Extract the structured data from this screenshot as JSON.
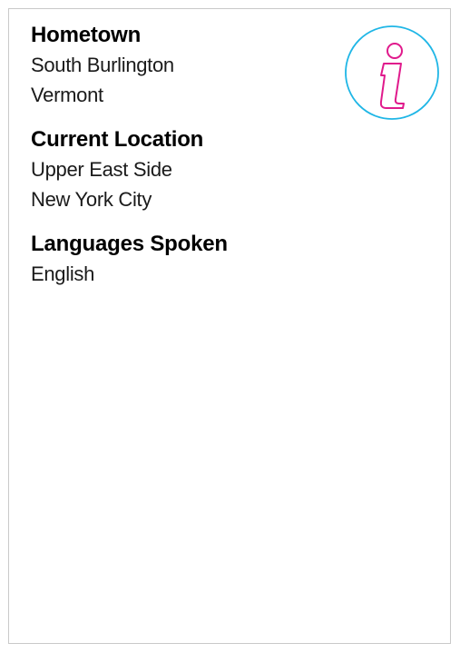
{
  "profile": {
    "sections": [
      {
        "heading": "Hometown",
        "lines": [
          "South Burlington",
          "Vermont"
        ]
      },
      {
        "heading": "Current Location",
        "lines": [
          "Upper East Side",
          "New York City"
        ]
      },
      {
        "heading": "Languages Spoken",
        "lines": [
          "English"
        ]
      }
    ]
  },
  "icon": {
    "name": "info-icon",
    "ring_color": "#1fb6e6",
    "glyph_color": "#e01a8c"
  }
}
